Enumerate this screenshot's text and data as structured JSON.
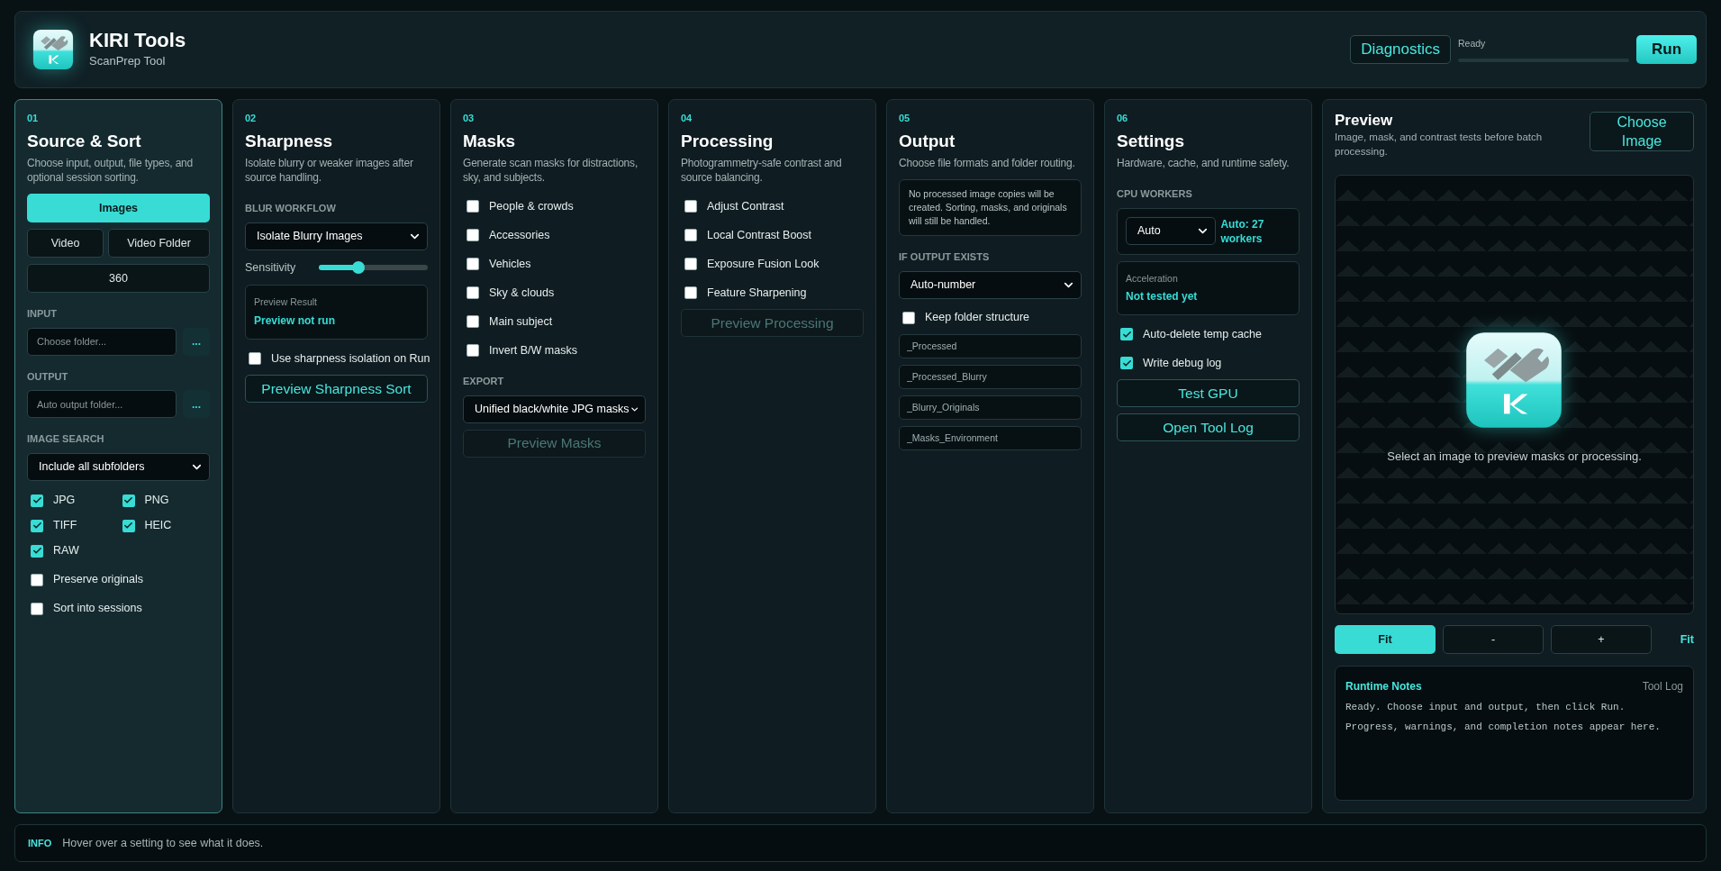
{
  "header": {
    "title": "KIRI Tools",
    "subtitle": "ScanPrep Tool",
    "diagnostics": "Diagnostics",
    "status": "Ready",
    "level": 0,
    "run": "Run"
  },
  "sections": [
    {
      "number": "01",
      "title": "Source & Sort",
      "description": "Choose input, output, file types, and optional session sorting.",
      "selected": true,
      "items": [
        {
          "kind": "segmented",
          "rows": [
            [
              {
                "label": "Images",
                "selected": true
              }
            ],
            [
              {
                "label": "Video",
                "selected": false
              },
              {
                "label": "Video Folder",
                "selected": false
              }
            ],
            [
              {
                "label": "360",
                "selected": false
              }
            ]
          ]
        },
        {
          "kind": "label",
          "text": "INPUT"
        },
        {
          "kind": "path_field",
          "placeholder": "Choose folder...",
          "browse": "..."
        },
        {
          "kind": "label",
          "text": "OUTPUT"
        },
        {
          "kind": "path_field",
          "placeholder": "Auto output folder...",
          "browse": "..."
        },
        {
          "kind": "label",
          "text": "IMAGE SEARCH"
        },
        {
          "kind": "select",
          "value": "Include all subfolders"
        },
        {
          "kind": "checkbox_grid",
          "items": [
            {
              "label": "JPG",
              "checked": true
            },
            {
              "label": "PNG",
              "checked": true
            },
            {
              "label": "TIFF",
              "checked": true
            },
            {
              "label": "HEIC",
              "checked": true
            },
            {
              "label": "RAW",
              "checked": true
            }
          ]
        },
        {
          "kind": "checkbox",
          "label": "Preserve originals",
          "checked": false
        },
        {
          "kind": "checkbox",
          "label": "Sort into sessions",
          "checked": false
        }
      ]
    },
    {
      "number": "02",
      "title": "Sharpness",
      "description": "Isolate blurry or weaker images after source handling.",
      "selected": false,
      "items": [
        {
          "kind": "label",
          "text": "BLUR WORKFLOW"
        },
        {
          "kind": "select",
          "value": "Isolate Blurry Images"
        },
        {
          "kind": "slider",
          "label": "Sensitivity",
          "level": 0.36
        },
        {
          "kind": "result",
          "label": "Preview Result",
          "value": "Preview not run"
        },
        {
          "kind": "checkbox",
          "label": "Use sharpness isolation on Run",
          "checked": false
        },
        {
          "kind": "button",
          "label": "Preview Sharpness Sort",
          "disabled": false
        }
      ]
    },
    {
      "number": "03",
      "title": "Masks",
      "description": "Generate scan masks for distractions, sky, and subjects.",
      "selected": false,
      "items": [
        {
          "kind": "checkbox",
          "label": "People & crowds",
          "checked": false
        },
        {
          "kind": "checkbox",
          "label": "Accessories",
          "checked": false
        },
        {
          "kind": "checkbox",
          "label": "Vehicles",
          "checked": false
        },
        {
          "kind": "checkbox",
          "label": "Sky & clouds",
          "checked": false
        },
        {
          "kind": "checkbox",
          "label": "Main subject",
          "checked": false
        },
        {
          "kind": "checkbox",
          "label": "Invert B/W masks",
          "checked": false
        },
        {
          "kind": "label",
          "text": "EXPORT"
        },
        {
          "kind": "select",
          "value": "Unified black/white JPG masks"
        },
        {
          "kind": "button",
          "label": "Preview Masks",
          "disabled": true
        }
      ]
    },
    {
      "number": "04",
      "title": "Processing",
      "description": "Photogrammetry-safe contrast and source balancing.",
      "selected": false,
      "items": [
        {
          "kind": "checkbox",
          "label": "Adjust Contrast",
          "checked": false
        },
        {
          "kind": "checkbox",
          "label": "Local Contrast Boost",
          "checked": false
        },
        {
          "kind": "checkbox",
          "label": "Exposure Fusion Look",
          "checked": false
        },
        {
          "kind": "checkbox",
          "label": "Feature Sharpening",
          "checked": false
        },
        {
          "kind": "button",
          "label": "Preview Processing",
          "disabled": true
        }
      ]
    },
    {
      "number": "05",
      "title": "Output",
      "description": "Choose file formats and folder routing.",
      "selected": false,
      "items": [
        {
          "kind": "note",
          "text": "No processed image copies will be created. Sorting, masks, and originals will still be handled."
        },
        {
          "kind": "label",
          "text": "IF OUTPUT EXISTS"
        },
        {
          "kind": "select",
          "value": "Auto-number"
        },
        {
          "kind": "checkbox",
          "label": "Keep folder structure",
          "checked": false
        },
        {
          "kind": "text_field",
          "value": "_Processed"
        },
        {
          "kind": "text_field",
          "value": "_Processed_Blurry"
        },
        {
          "kind": "text_field",
          "value": "_Blurry_Originals"
        },
        {
          "kind": "text_field",
          "value": "_Masks_Environment"
        }
      ]
    },
    {
      "number": "06",
      "title": "Settings",
      "description": "Hardware, cache, and runtime safety.",
      "selected": false,
      "items": [
        {
          "kind": "label",
          "text": "CPU WORKERS"
        },
        {
          "kind": "select_info",
          "value": "Auto",
          "info": "Auto: 27 workers"
        },
        {
          "kind": "result",
          "label": "Acceleration",
          "value": "Not tested yet"
        },
        {
          "kind": "checkbox",
          "label": "Auto-delete temp cache",
          "checked": true
        },
        {
          "kind": "checkbox",
          "label": "Write debug log",
          "checked": true
        },
        {
          "kind": "button",
          "label": "Test GPU",
          "disabled": false
        },
        {
          "kind": "button",
          "label": "Open Tool Log",
          "disabled": false
        }
      ]
    }
  ],
  "preview": {
    "title": "Preview",
    "description": "Image, mask, and contrast tests before batch processing.",
    "choose": "Choose Image",
    "hint": "Select an image to preview masks or processing.",
    "zoom_buttons": [
      {
        "label": "Fit",
        "selected": true
      },
      {
        "label": "-",
        "selected": false
      },
      {
        "label": "+",
        "selected": false
      }
    ],
    "zoom_readout": "Fit",
    "notes": {
      "title": "Runtime Notes",
      "link": "Tool Log",
      "lines": [
        "Ready. Choose input and output, then click Run.",
        "Progress, warnings, and completion notes appear here."
      ]
    }
  },
  "info": {
    "tag": "INFO",
    "text": "Hover over a setting to see what it does."
  }
}
